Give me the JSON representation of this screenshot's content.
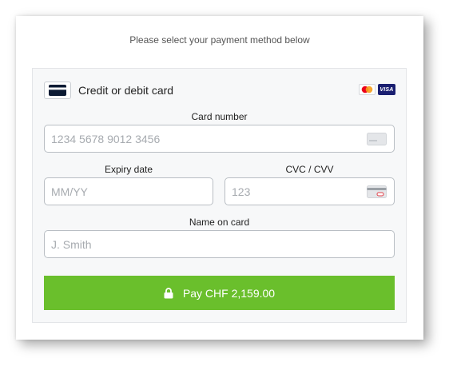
{
  "header": {
    "instruction": "Please select your payment method below"
  },
  "payment_method": {
    "label": "Credit or debit card",
    "icon": "credit-card-icon",
    "brands": [
      {
        "name": "mastercard-logo"
      },
      {
        "name": "visa-logo",
        "text": "VISA"
      }
    ]
  },
  "colors": {
    "accent": "#6abf2c",
    "visa_blue": "#1a1f71",
    "mc_red": "#eb001b",
    "mc_orange": "#f79e1b"
  },
  "form": {
    "card_number": {
      "label": "Card number",
      "placeholder": "1234 5678 9012 3456",
      "value": ""
    },
    "expiry": {
      "label": "Expiry date",
      "placeholder": "MM/YY",
      "value": ""
    },
    "cvc": {
      "label": "CVC / CVV",
      "placeholder": "123",
      "value": ""
    },
    "name": {
      "label": "Name on card",
      "placeholder": "J. Smith",
      "value": ""
    }
  },
  "pay_button": {
    "label": "Pay CHF 2,159.00",
    "icon": "lock-icon"
  }
}
